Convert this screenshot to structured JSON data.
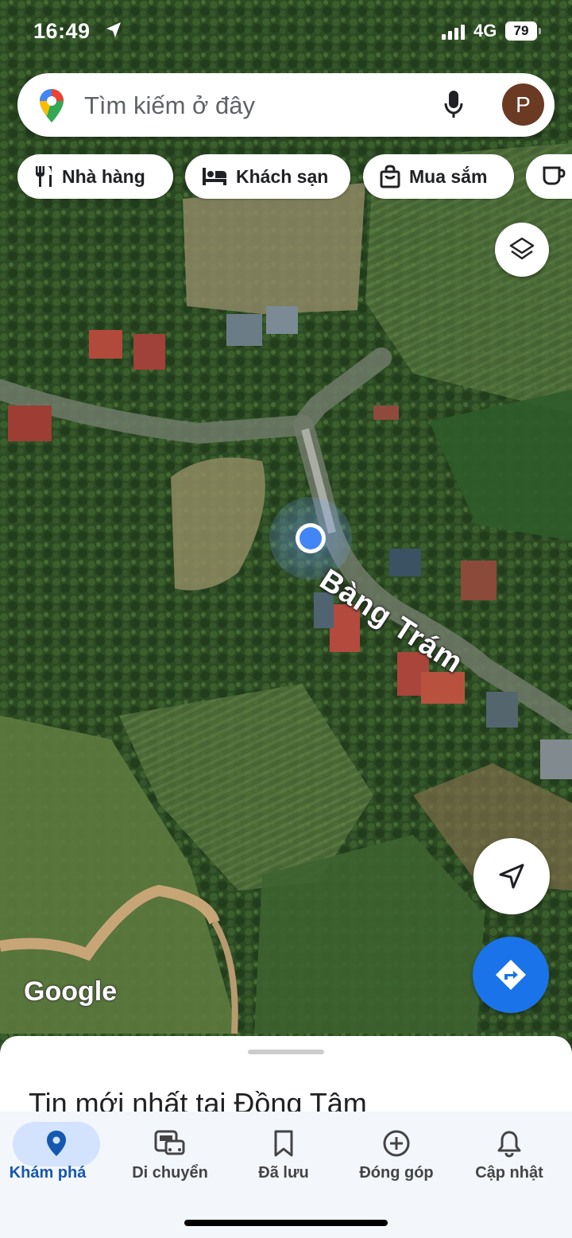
{
  "status_bar": {
    "time": "16:49",
    "network": "4G",
    "battery": "79"
  },
  "search": {
    "placeholder": "Tìm kiếm ở đây",
    "avatar_initial": "P"
  },
  "chips": [
    {
      "label": "Nhà hàng",
      "icon": "restaurant-icon"
    },
    {
      "label": "Khách sạn",
      "icon": "hotel-icon"
    },
    {
      "label": "Mua sắm",
      "icon": "shopping-bag-icon"
    },
    {
      "label": "",
      "icon": "coffee-icon"
    }
  ],
  "map": {
    "road_label": "Bàng Trám",
    "attribution": "Google"
  },
  "sheet": {
    "title": "Tin mới nhất tại Đồng Tâm"
  },
  "nav": [
    {
      "label": "Khám phá",
      "icon": "explore-pin-icon",
      "active": true
    },
    {
      "label": "Di chuyển",
      "icon": "commute-icon",
      "active": false
    },
    {
      "label": "Đã lưu",
      "icon": "bookmark-icon",
      "active": false
    },
    {
      "label": "Đóng góp",
      "icon": "add-circle-icon",
      "active": false
    },
    {
      "label": "Cập nhật",
      "icon": "bell-icon",
      "active": false
    }
  ],
  "colors": {
    "accent": "#1a73e8",
    "active_pill": "#d3e3fd",
    "location_dot": "#4285f4"
  }
}
